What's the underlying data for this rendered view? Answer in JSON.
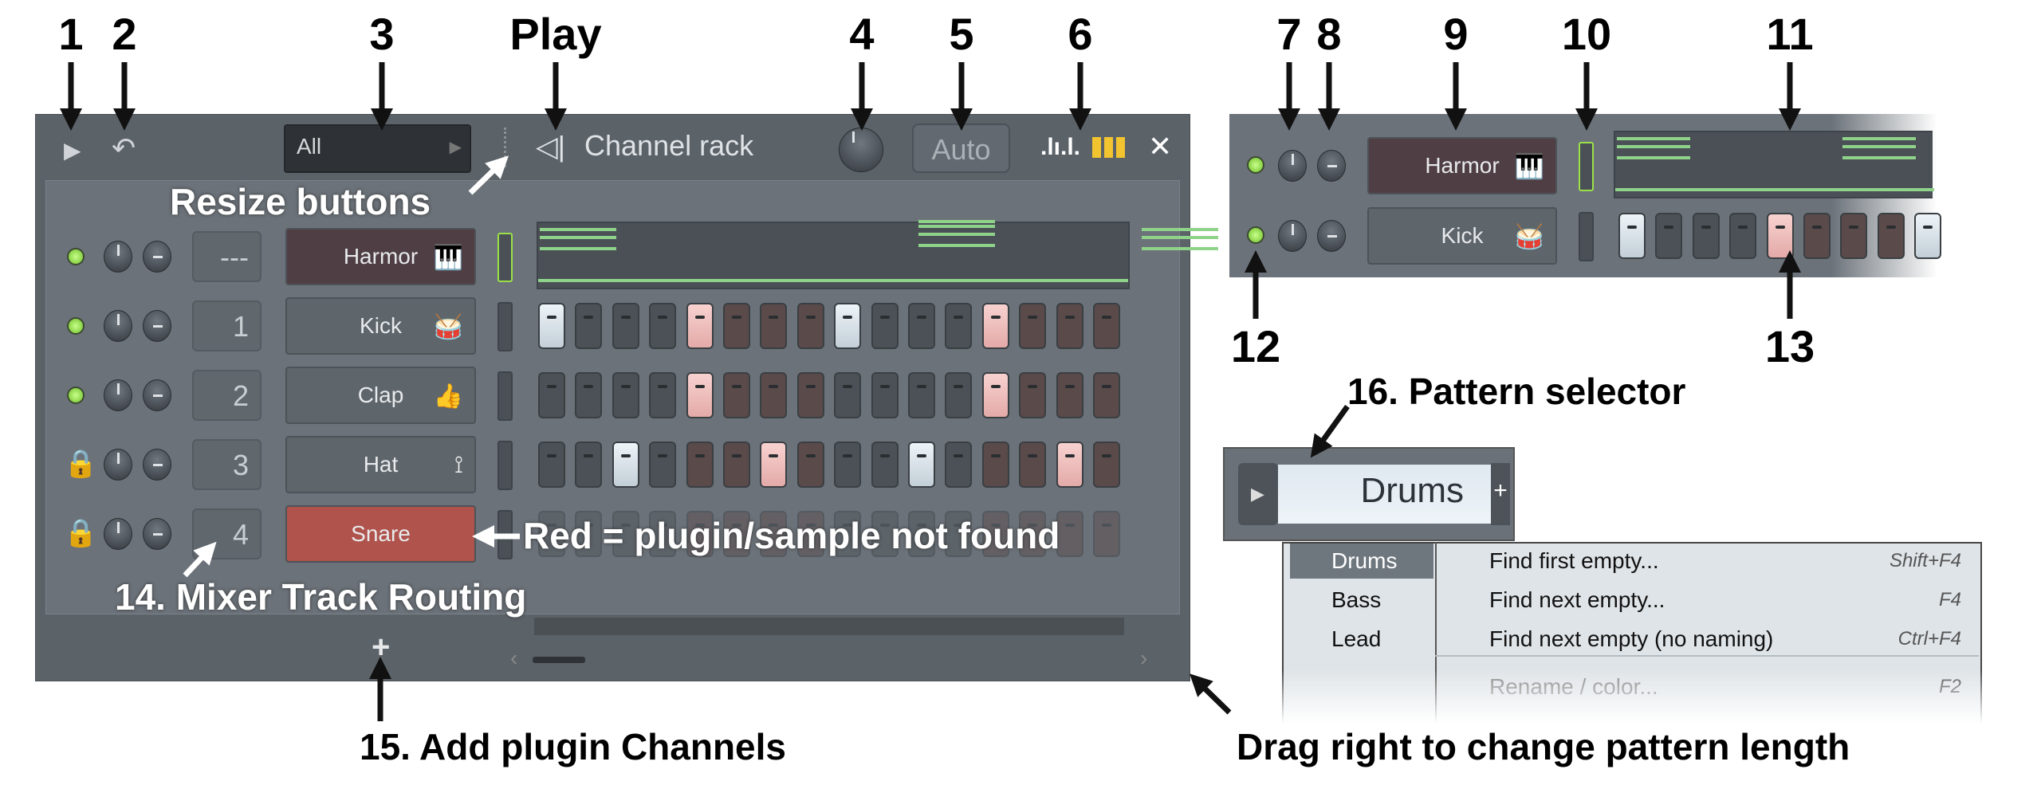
{
  "window": {
    "title": "Channel rack",
    "filter": "All",
    "swing_label": "Auto",
    "close": "✕"
  },
  "channels": [
    {
      "name": "Harmor",
      "mixer": "---",
      "status": "on",
      "icon": "piano-icon",
      "icon_char": "🎹",
      "color": "#4f3f45",
      "graph": true
    },
    {
      "name": "Kick",
      "mixer": "1",
      "status": "on",
      "icon": "drum-icon",
      "icon_char": "🥁",
      "color": "#5e656b",
      "steps": [
        1,
        0,
        0,
        0,
        1,
        0,
        0,
        0,
        1,
        0,
        0,
        0,
        1,
        0,
        0,
        0
      ]
    },
    {
      "name": "Clap",
      "mixer": "2",
      "status": "on",
      "icon": "thumbs-up-icon",
      "icon_char": "👍",
      "color": "#5e656b",
      "steps": [
        0,
        0,
        0,
        0,
        1,
        0,
        0,
        0,
        0,
        0,
        0,
        0,
        1,
        0,
        0,
        0
      ]
    },
    {
      "name": "Hat",
      "mixer": "3",
      "status": "locked",
      "icon": "cymbal-icon",
      "icon_char": "⟟",
      "color": "#5e656b",
      "steps": [
        0,
        0,
        1,
        0,
        0,
        0,
        1,
        0,
        0,
        0,
        1,
        0,
        0,
        0,
        1,
        0
      ]
    },
    {
      "name": "Snare",
      "mixer": "4",
      "status": "unlocked",
      "icon": "",
      "icon_char": "",
      "color": "#b0534c",
      "steps": [
        0,
        0,
        0,
        0,
        0,
        0,
        0,
        0,
        0,
        0,
        0,
        0,
        0,
        0,
        0,
        0
      ]
    }
  ],
  "zoom_panel": {
    "channels": [
      {
        "name": "Harmor",
        "icon_char": "🎹",
        "color": "#4f3f45"
      },
      {
        "name": "Kick",
        "icon_char": "🥁",
        "color": "#5e656b",
        "steps": [
          1,
          0,
          0,
          0,
          1,
          0,
          0,
          0,
          1
        ]
      }
    ]
  },
  "pattern_selector": {
    "value": "Drums",
    "add": "+",
    "patterns": [
      "Drums",
      "Bass",
      "Lead"
    ],
    "menu": [
      {
        "label": "Find first empty...",
        "shortcut": "Shift+F4"
      },
      {
        "label": "Find next empty...",
        "shortcut": "F4"
      },
      {
        "label": "Find next empty (no naming)",
        "shortcut": "Ctrl+F4"
      },
      {
        "label": "Rename / color...",
        "shortcut": "F2"
      }
    ]
  },
  "annotations": {
    "n1": "1",
    "n2": "2",
    "n3": "3",
    "play": "Play",
    "n4": "4",
    "n5": "5",
    "n6": "6",
    "n7": "7",
    "n8": "8",
    "n9": "9",
    "n10": "10",
    "n11": "11",
    "n12": "12",
    "n13": "13",
    "resize": "Resize buttons",
    "red": "Red = plugin/sample not found",
    "mixer": "14. Mixer Track Routing",
    "add": "15. Add plugin Channels",
    "pattern": "16. Pattern selector",
    "drag": "Drag right to change pattern length"
  },
  "colors": {
    "led": "#8fdc4a",
    "step_on_light": "#dfe8ef",
    "step_on_pink": "#f0c0be",
    "missing": "#b0534c",
    "graph_line": "#8fd28a"
  }
}
